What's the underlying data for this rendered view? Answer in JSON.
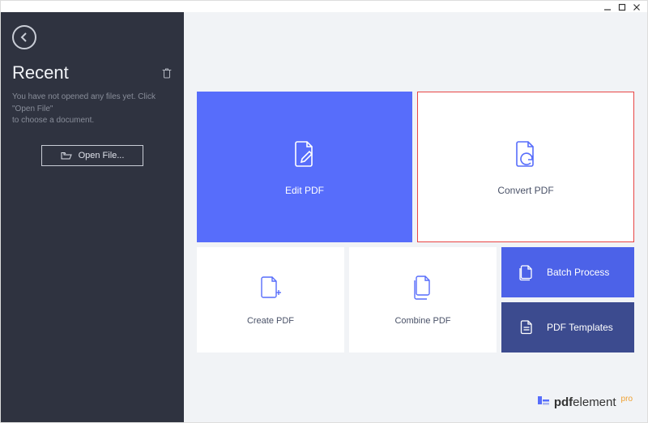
{
  "sidebar": {
    "title": "Recent",
    "hint_line1": "You have not opened any files yet. Click \"Open File\"",
    "hint_line2": "to choose a document.",
    "open_file_label": "Open File..."
  },
  "tiles": {
    "edit": "Edit PDF",
    "convert": "Convert PDF",
    "create": "Create PDF",
    "combine": "Combine PDF",
    "batch": "Batch Process",
    "templates": "PDF Templates"
  },
  "brand": {
    "name_bold": "pdf",
    "name_rest": "element",
    "edition": "pro"
  },
  "colors": {
    "sidebar_bg": "#2f3340",
    "accent": "#576DFB",
    "accent_dark": "#4C62E8",
    "accent_darker": "#3C4B8F",
    "highlight_border": "#e84545",
    "canvas": "#f1f3f6"
  }
}
